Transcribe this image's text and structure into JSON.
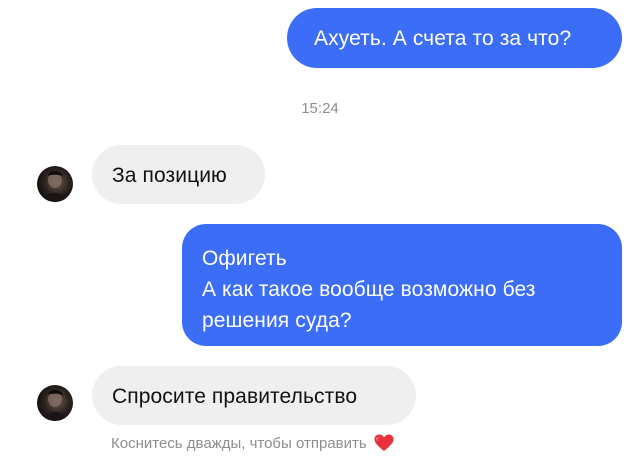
{
  "messages": [
    {
      "direction": "outgoing",
      "lines": [
        "Ахуеть. А счета то за что?"
      ]
    },
    {
      "direction": "incoming",
      "lines": [
        "За позицию"
      ]
    },
    {
      "direction": "outgoing",
      "lines": [
        "Офигеть",
        "А как такое вообще возможно без",
        "решения суда?"
      ]
    },
    {
      "direction": "incoming",
      "lines": [
        "Спросите правительство"
      ]
    }
  ],
  "timestamp": "15:24",
  "hint": {
    "text": "Коснитесь дважды, чтобы отправить",
    "icon": "heart-icon"
  },
  "colors": {
    "outgoing_bubble": "#3b6df6",
    "incoming_bubble": "#efefef",
    "meta_text": "#8e8e8e",
    "heart": "#e8323c"
  }
}
